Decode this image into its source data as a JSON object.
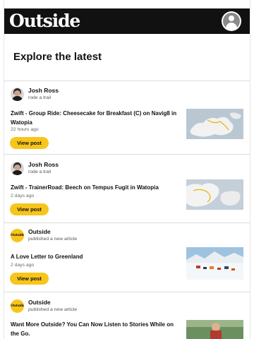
{
  "header": {
    "logo_text": "Outside"
  },
  "page": {
    "title": "Explore the latest"
  },
  "colors": {
    "accent": "#f7c51b",
    "header_bg": "#111111"
  },
  "button_label": "View post",
  "feed": [
    {
      "author": "Josh Ross",
      "action": "rode a trail",
      "avatar": "person-avatar",
      "title": "Zwift - Group Ride: Cheesecake for Breakfast (C) on Navig8 in Watopia",
      "time": "22 hours ago",
      "thumb": "route-map-thumbnail"
    },
    {
      "author": "Josh Ross",
      "action": "rode a trail",
      "avatar": "person-avatar",
      "title": "Zwift - TrainerRoad: Beech on Tempus Fugit in Watopia",
      "time": "2 days ago",
      "thumb": "route-map-thumbnail"
    },
    {
      "author": "Outside",
      "action": "published a new article",
      "avatar": "outside-logo-avatar",
      "avatar_text": "Outside",
      "title": "A Love Letter to Greenland",
      "time": "2 days ago",
      "thumb": "greenland-photo"
    },
    {
      "author": "Outside",
      "action": "published a new article",
      "avatar": "outside-logo-avatar",
      "avatar_text": "Outside",
      "title": "Want More Outside? You Can Now Listen to Stories While on the Go.",
      "thumb": "article-photo"
    }
  ]
}
